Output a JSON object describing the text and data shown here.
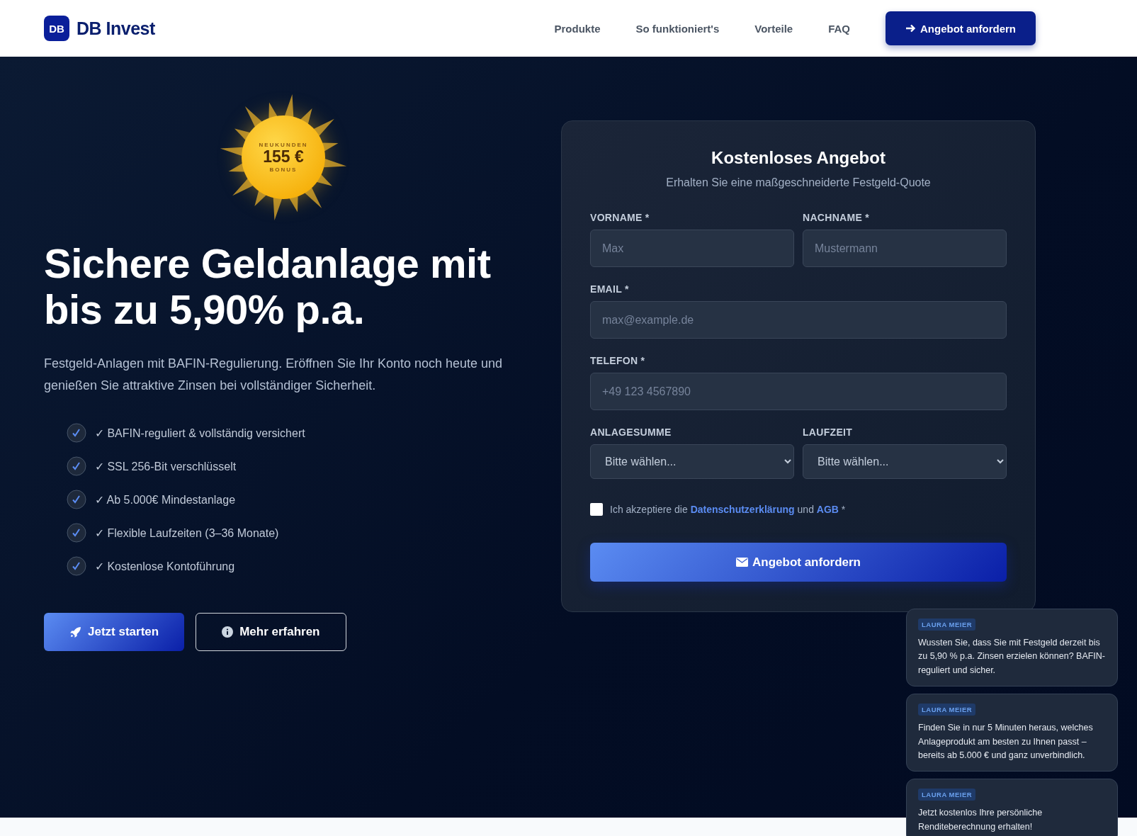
{
  "header": {
    "logo_mark": "DB",
    "logo_text": "DB Invest",
    "nav": [
      "Produkte",
      "So funktioniert's",
      "Vorteile",
      "FAQ"
    ],
    "cta": "Angebot anfordern"
  },
  "hero": {
    "badge": {
      "top": "NEUKUNDEN",
      "amount": "155 €",
      "bottom": "BONUS"
    },
    "title": "Sichere Geldanlage mit bis zu 5,90% p.a.",
    "lead": "Festgeld-Anlagen mit BAFIN-Regulierung. Eröffnen Sie Ihr Konto noch heute und genießen Sie attraktive Zinsen bei vollständiger Sicherheit.",
    "features": [
      "✓ BAFIN-reguliert & vollständig versichert",
      "✓ SSL 256-Bit verschlüsselt",
      "✓ Ab 5.000€ Mindestanlage",
      "✓ Flexible Laufzeiten (3–36 Monate)",
      "✓ Kostenlose Kontoführung"
    ],
    "buttons": [
      {
        "kind": "primary",
        "label": "Jetzt starten"
      },
      {
        "kind": "outline",
        "label": "Mehr erfahren"
      }
    ]
  },
  "form": {
    "title": "Kostenloses Angebot",
    "subtitle": "Erhalten Sie eine maßgeschneiderte Festgeld-Quote",
    "rows": [
      [
        {
          "kind": "input",
          "label": "VORNAME *",
          "placeholder": "Max"
        },
        {
          "kind": "input",
          "label": "NACHNAME *",
          "placeholder": "Mustermann"
        }
      ],
      [
        {
          "kind": "input",
          "label": "EMAIL *",
          "placeholder": "max@example.de"
        }
      ],
      [
        {
          "kind": "input",
          "label": "TELEFON *",
          "placeholder": "+49 123 4567890"
        }
      ],
      [
        {
          "kind": "select",
          "label": "ANLAGESUMME",
          "value": "Bitte wählen..."
        },
        {
          "kind": "select",
          "label": "LAUFZEIT",
          "value": "Bitte wählen..."
        }
      ]
    ],
    "consent": {
      "checked": false,
      "before": "Ich akzeptiere die",
      "link1": "Datenschutzerklärung",
      "middle": "und",
      "link2": "AGB",
      "after": "*"
    },
    "submit": "Angebot anfordern"
  },
  "chat": [
    {
      "sender": "LAURA MEIER",
      "text": "Wussten Sie, dass Sie mit Festgeld derzeit bis zu 5,90 % p.a. Zinsen erzielen können? BAFIN-reguliert und sicher."
    },
    {
      "sender": "LAURA MEIER",
      "text": "Finden Sie in nur 5 Minuten heraus, welches Anlageprodukt am besten zu Ihnen passt – bereits ab 5.000 € und ganz unverbindlich."
    },
    {
      "sender": "LAURA MEIER",
      "text": "Jetzt kostenlos Ihre persönliche Renditeberechnung erhalten!"
    }
  ]
}
